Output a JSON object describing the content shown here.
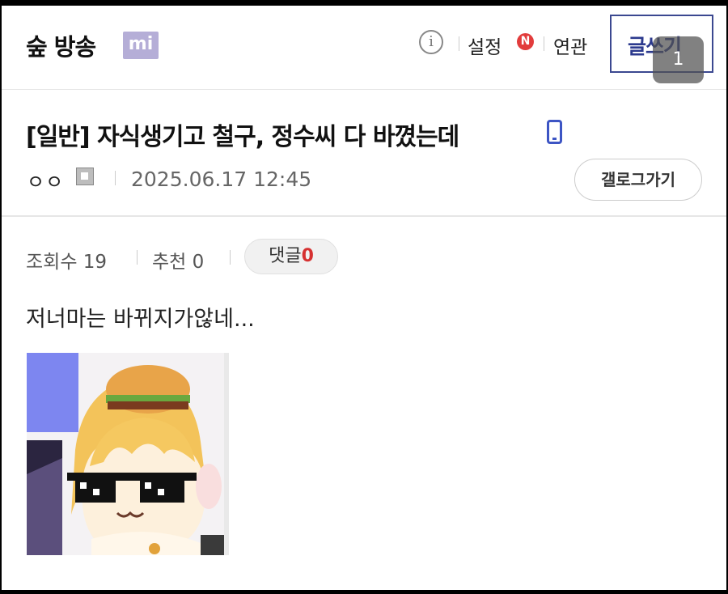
{
  "header": {
    "gallery_title": "숲 방송",
    "badge": "mi",
    "info_icon": "i",
    "settings_label": "설정",
    "new_badge": "N",
    "related_label": "연관",
    "write_label": "글쓰기",
    "notification_count": "1"
  },
  "post": {
    "title": "[일반] 자식생기고 철구, 정수씨 다 바꼈는데",
    "author": "ㅇㅇ",
    "date": "2025.06.17 12:45",
    "gallery_button": "갤로그가기",
    "views_label": "조회수 19",
    "recommend_label": "추천 0",
    "comments_label": "댓글",
    "comments_count": "0",
    "body": "저너마는 바뀌지가않네..."
  },
  "colors": {
    "accent": "#2c3a8e",
    "badge": "#b5aed7",
    "new_badge": "#e23c3c",
    "mobile_icon": "#3d55c4"
  }
}
